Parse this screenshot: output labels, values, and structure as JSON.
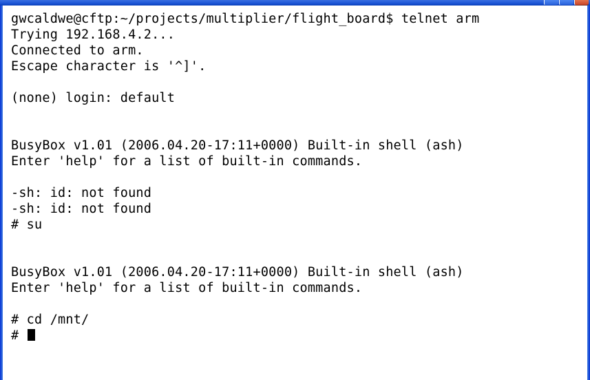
{
  "terminal": {
    "lines": [
      "gwcaldwe@cftp:~/projects/multiplier/flight_board$ telnet arm",
      "Trying 192.168.4.2...",
      "Connected to arm.",
      "Escape character is '^]'.",
      "",
      "(none) login: default",
      "",
      "",
      "BusyBox v1.01 (2006.04.20-17:11+0000) Built-in shell (ash)",
      "Enter 'help' for a list of built-in commands.",
      "",
      "-sh: id: not found",
      "-sh: id: not found",
      "# su",
      "",
      "",
      "BusyBox v1.01 (2006.04.20-17:11+0000) Built-in shell (ash)",
      "Enter 'help' for a list of built-in commands.",
      "",
      "# cd /mnt/",
      "# "
    ]
  },
  "colors": {
    "background": "#ffffff",
    "text": "#000000",
    "frame_blue": "#1c55d6",
    "close_red": "#c8452a"
  }
}
